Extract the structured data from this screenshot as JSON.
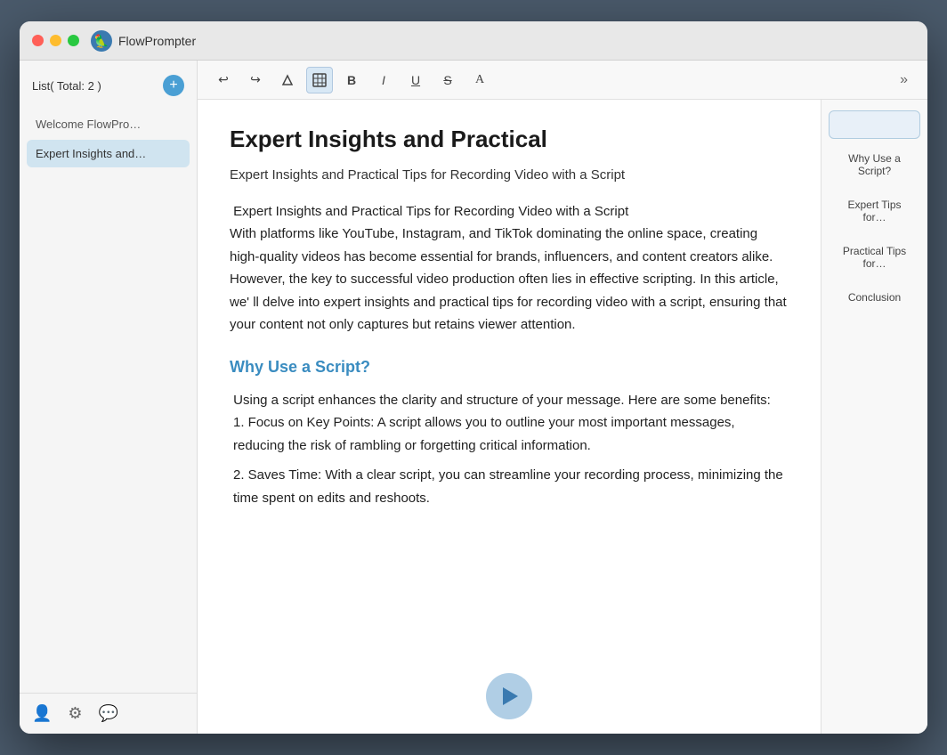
{
  "app": {
    "name": "FlowPrompter"
  },
  "sidebar": {
    "header_label": "List( Total: 2 )",
    "items": [
      {
        "id": "item-1",
        "label": "Welcome FlowPro…",
        "active": false
      },
      {
        "id": "item-2",
        "label": "Expert Insights and…",
        "active": true
      }
    ]
  },
  "toolbar": {
    "buttons": [
      {
        "id": "undo",
        "symbol": "↩",
        "label": "Undo"
      },
      {
        "id": "redo",
        "symbol": "↪",
        "label": "Redo"
      },
      {
        "id": "erase",
        "symbol": "◇",
        "label": "Erase"
      },
      {
        "id": "table",
        "symbol": "⊞",
        "label": "Table",
        "active": true
      },
      {
        "id": "bold",
        "symbol": "B",
        "label": "Bold"
      },
      {
        "id": "italic",
        "symbol": "I",
        "label": "Italic"
      },
      {
        "id": "underline",
        "symbol": "U",
        "label": "Underline"
      },
      {
        "id": "strikethrough",
        "symbol": "S",
        "label": "Strikethrough"
      },
      {
        "id": "font",
        "symbol": "A",
        "label": "Font"
      }
    ],
    "more_label": "»"
  },
  "editor": {
    "title": "Expert Insights and Practical",
    "subtitle": "Expert Insights and Practical Tips for Recording Video with a Script",
    "intro_paragraph": " Expert Insights and Practical Tips for Recording Video with a Script\nWith platforms like YouTube, Instagram, and TikTok dominating the online space, creating high-quality videos has become essential for brands, influencers, and content creators alike. However, the key to successful video production often lies in effective scripting. In this article, we' ll delve into expert insights and practical tips for recording video with a script, ensuring that your content not only captures but retains viewer attention.",
    "section1_heading": "Why Use a Script?",
    "section1_body": " Using a script enhances the clarity and structure of your message. Here are some benefits:",
    "section1_item1": "1. Focus on Key Points: A script allows you to outline your most important messages, reducing the risk of rambling or forgetting critical information.",
    "section1_item2": "2. Saves Time: With a clear script, you can streamline your recording process, minimizing the time spent on edits and reshoots."
  },
  "outline": {
    "items": [
      {
        "id": "outline-top",
        "label": "",
        "active_first": true
      },
      {
        "id": "outline-why",
        "label": "Why Use a Script?",
        "active": false
      },
      {
        "id": "outline-expert",
        "label": "Expert Tips for…",
        "active": false
      },
      {
        "id": "outline-practical",
        "label": "Practical Tips for…",
        "active": false
      },
      {
        "id": "outline-conclusion",
        "label": "Conclusion",
        "active": false
      }
    ]
  },
  "footer_icons": {
    "user": "👤",
    "settings": "⚙",
    "help": "💬"
  }
}
